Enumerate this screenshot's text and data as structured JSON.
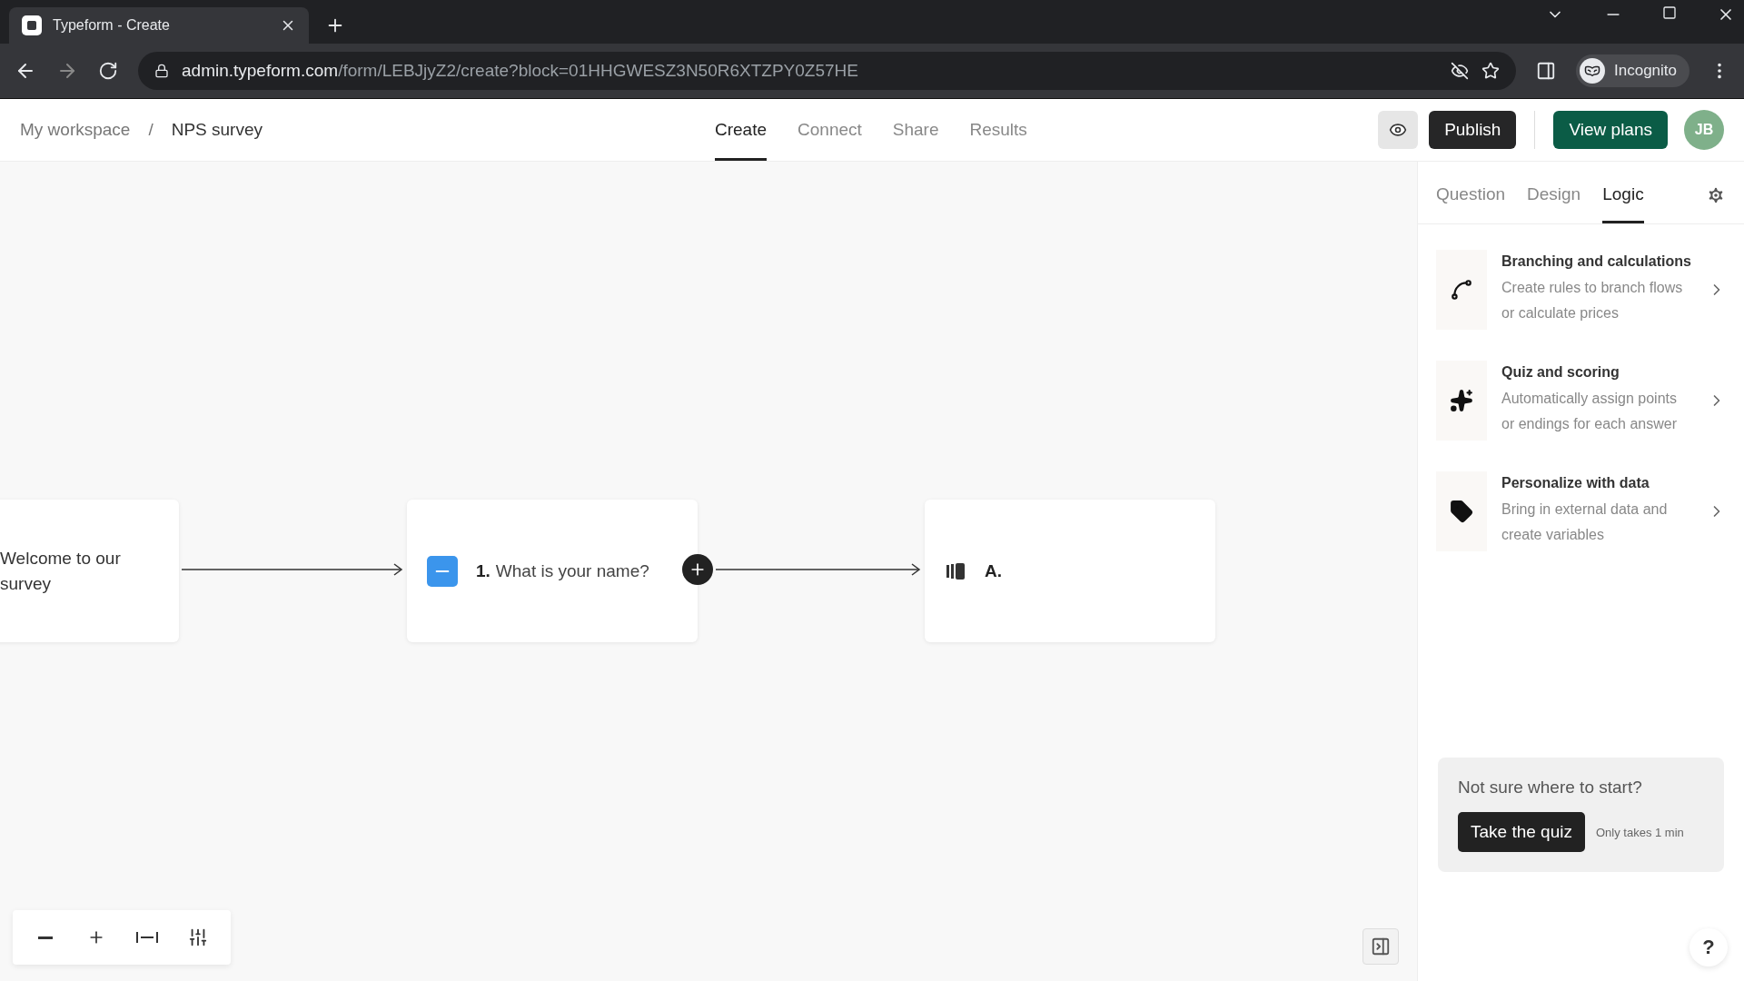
{
  "browser": {
    "tab_title": "Typeform - Create",
    "url_host": "admin.typeform.com",
    "url_path": "/form/LEBJjyZ2/create?block=01HHGWESZ3N50R6XTZPY0Z57HE",
    "profile": "Incognito"
  },
  "header": {
    "breadcrumbs": [
      "My workspace",
      "NPS survey"
    ],
    "separator": "/",
    "nav": [
      {
        "label": "Create",
        "selected": true
      },
      {
        "label": "Connect",
        "selected": false
      },
      {
        "label": "Share",
        "selected": false
      },
      {
        "label": "Results",
        "selected": false
      }
    ],
    "publish": "Publish",
    "view_plans": "View plans",
    "avatar": "JB"
  },
  "canvas": {
    "welcome": {
      "lines": [
        "Welcome to our",
        "survey"
      ]
    },
    "question": {
      "number": "1.",
      "text": "What is your name?"
    },
    "ending": {
      "label": "A."
    }
  },
  "panel": {
    "tabs": [
      {
        "label": "Question",
        "selected": false
      },
      {
        "label": "Design",
        "selected": false
      },
      {
        "label": "Logic",
        "selected": true
      }
    ],
    "items": [
      {
        "kind": "branch",
        "title": "Branching and calculations",
        "description": "Create rules to branch flows or calculate prices"
      },
      {
        "kind": "sparkle",
        "title": "Quiz and scoring",
        "description": "Automatically assign points or endings for each answer"
      },
      {
        "kind": "tag",
        "title": "Personalize with data",
        "description": "Bring in external data and create variables"
      }
    ],
    "help_card": {
      "title": "Not sure where to start?",
      "button": "Take the quiz",
      "note": "Only takes 1 min"
    },
    "help": "?"
  }
}
